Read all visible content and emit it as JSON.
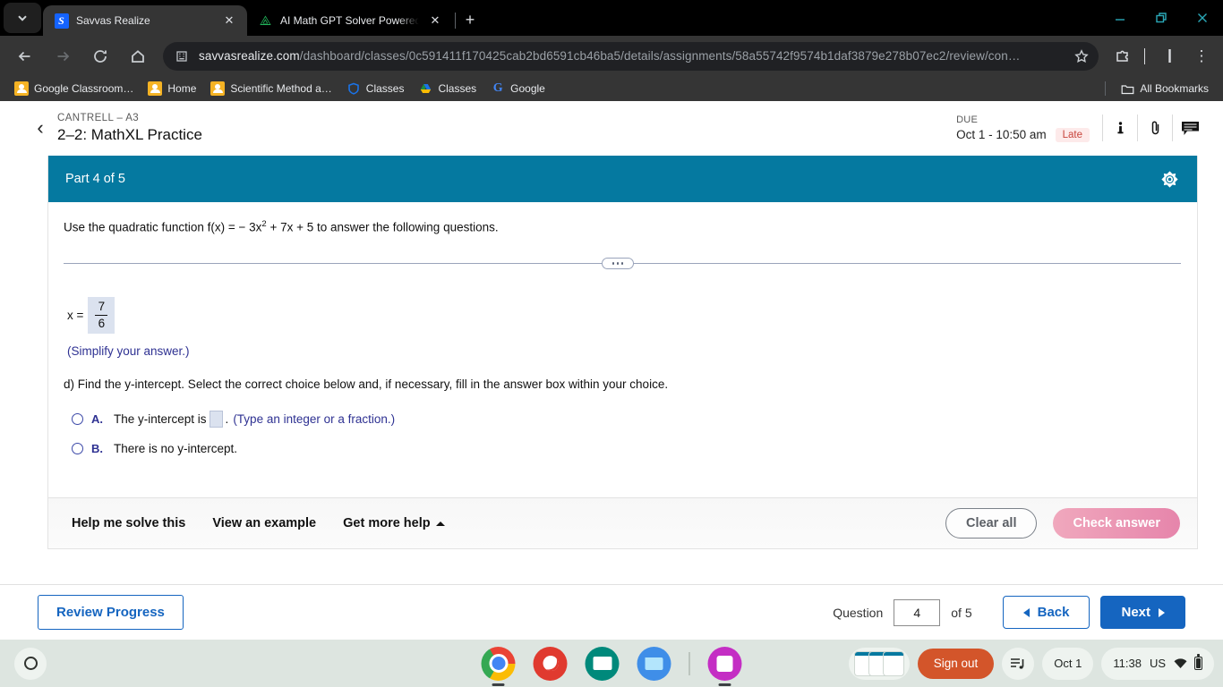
{
  "browser": {
    "tabs": [
      {
        "title": "Savvas Realize",
        "favicon": "savvas-icon",
        "active": true
      },
      {
        "title": "AI Math GPT Solver Powered by",
        "favicon": "compass-icon",
        "active": false
      }
    ],
    "new_tab_label": "+",
    "omnibox": {
      "domain": "savvasrealize.com",
      "path": "/dashboard/classes/0c591411f170425cab2bd6591cb46ba5/details/assignments/58a55742f9574b1daf3879e278b07ec2/review/con…",
      "site_icon": "site-info-icon",
      "star_icon": "bookmark-star-icon"
    },
    "bookmarks": [
      {
        "label": "Google Classroom…",
        "icon": "classroom-icon"
      },
      {
        "label": "Home",
        "icon": "classroom-icon"
      },
      {
        "label": "Scientific Method a…",
        "icon": "classroom-icon"
      },
      {
        "label": "Classes",
        "icon": "shield-icon"
      },
      {
        "label": "Classes",
        "icon": "drive-icon"
      },
      {
        "label": "Google",
        "icon": "google-icon"
      }
    ],
    "all_bookmarks_label": "All Bookmarks",
    "window_controls": {
      "minimize": "minimize-icon",
      "maximize": "restore-icon",
      "close": "close-icon"
    }
  },
  "assignment": {
    "class_name": "CANTRELL – A3",
    "title": "2–2: MathXL Practice",
    "back_icon": "chevron-left-icon",
    "due_label": "DUE",
    "due_value": "Oct 1 - 10:50 am",
    "late_badge": "Late",
    "icons": [
      "info-icon",
      "paperclip-icon",
      "comment-icon"
    ]
  },
  "exercise": {
    "part_label": "Part 4 of 5",
    "gear_icon": "gear-icon",
    "stem_prefix": "Use the quadratic function f(x) = ",
    "stem_expr_base": "− 3x",
    "stem_expr_sup": "2",
    "stem_expr_rest": " + 7x + 5",
    "stem_suffix": " to answer the following questions.",
    "splitter_icon": "drag-handle-dots",
    "previous_answer": {
      "label": "x =",
      "numerator": "7",
      "denominator": "6",
      "note": "(Simplify your answer.)"
    },
    "question_part": "d) Find the y-intercept. Select the correct choice below and, if necessary, fill in the answer box within your choice.",
    "choices": [
      {
        "letter": "A.",
        "text_before": "The y-intercept is",
        "input_value": "",
        "text_after": ".",
        "hint": "(Type an integer or a fraction.)",
        "selected": false
      },
      {
        "letter": "B.",
        "text_before": "There is no y-intercept.",
        "input_value": null,
        "text_after": "",
        "hint": "",
        "selected": false
      }
    ],
    "help_links": [
      {
        "label": "Help me solve this",
        "caret": false
      },
      {
        "label": "View an example",
        "caret": false
      },
      {
        "label": "Get more help",
        "caret": true
      }
    ],
    "clear_all_label": "Clear all",
    "check_answer_label": "Check answer"
  },
  "bottom_nav": {
    "review_label": "Review Progress",
    "question_label": "Question",
    "question_value": "4",
    "of_label": "of 5",
    "back_label": "Back",
    "next_label": "Next"
  },
  "shelf": {
    "launcher_icon": "launcher-circle-icon",
    "apps": [
      {
        "name": "chrome-app-icon",
        "running": true
      },
      {
        "name": "paint-app-icon",
        "running": false
      },
      {
        "name": "news-app-icon",
        "running": false
      },
      {
        "name": "files-app-icon",
        "running": false
      },
      {
        "name": "photos-app-icon",
        "running": true
      }
    ],
    "window_preview_icon": "browser-window-preview",
    "signout_label": "Sign out",
    "media_icon": "playlist-music-icon",
    "date": "Oct 1",
    "time": "11:38",
    "locale": "US",
    "wifi_icon": "wifi-icon",
    "battery_icon": "battery-icon"
  },
  "colors": {
    "accent_teal": "#0579a0",
    "link_blue": "#1565c0",
    "answer_navy": "#2e3192",
    "late_red": "#c8443c",
    "check_pink": "#e685ab",
    "signout_orange": "#d3552a"
  }
}
